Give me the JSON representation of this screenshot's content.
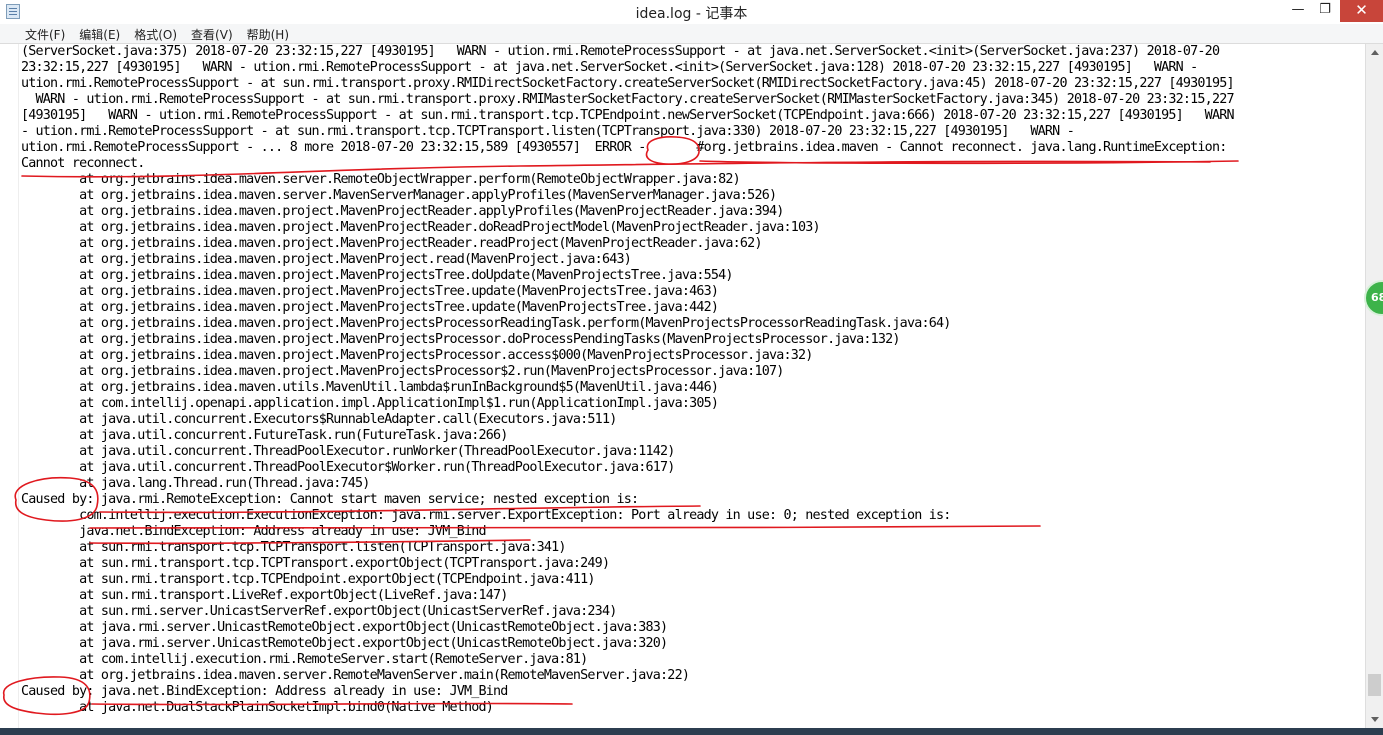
{
  "window": {
    "title": "idea.log - 记事本",
    "minimize_glyph": "—",
    "maximize_glyph": "❐",
    "close_glyph": "✕"
  },
  "menu": [
    "文件(F)",
    "编辑(E)",
    "格式(O)",
    "查看(V)",
    "帮助(H)"
  ],
  "log_lines": [
    "(ServerSocket.java:375) 2018-07-20 23:32:15,227 [4930195]   WARN - ution.rmi.RemoteProcessSupport - at java.net.ServerSocket.<init>(ServerSocket.java:237) 2018-07-20",
    "23:32:15,227 [4930195]   WARN - ution.rmi.RemoteProcessSupport - at java.net.ServerSocket.<init>(ServerSocket.java:128) 2018-07-20 23:32:15,227 [4930195]   WARN -",
    "ution.rmi.RemoteProcessSupport - at sun.rmi.transport.proxy.RMIDirectSocketFactory.createServerSocket(RMIDirectSocketFactory.java:45) 2018-07-20 23:32:15,227 [4930195]",
    "  WARN - ution.rmi.RemoteProcessSupport - at sun.rmi.transport.proxy.RMIMasterSocketFactory.createServerSocket(RMIMasterSocketFactory.java:345) 2018-07-20 23:32:15,227",
    "[4930195]   WARN - ution.rmi.RemoteProcessSupport - at sun.rmi.transport.tcp.TCPEndpoint.newServerSocket(TCPEndpoint.java:666) 2018-07-20 23:32:15,227 [4930195]   WARN",
    "- ution.rmi.RemoteProcessSupport - at sun.rmi.transport.tcp.TCPTransport.listen(TCPTransport.java:330) 2018-07-20 23:32:15,227 [4930195]   WARN -",
    "ution.rmi.RemoteProcessSupport - ... 8 more 2018-07-20 23:32:15,589 [4930557]  ERROR -       #org.jetbrains.idea.maven - Cannot reconnect. java.lang.RuntimeException:",
    "Cannot reconnect.",
    "        at org.jetbrains.idea.maven.server.RemoteObjectWrapper.perform(RemoteObjectWrapper.java:82)",
    "        at org.jetbrains.idea.maven.server.MavenServerManager.applyProfiles(MavenServerManager.java:526)",
    "        at org.jetbrains.idea.maven.project.MavenProjectReader.applyProfiles(MavenProjectReader.java:394)",
    "        at org.jetbrains.idea.maven.project.MavenProjectReader.doReadProjectModel(MavenProjectReader.java:103)",
    "        at org.jetbrains.idea.maven.project.MavenProjectReader.readProject(MavenProjectReader.java:62)",
    "        at org.jetbrains.idea.maven.project.MavenProject.read(MavenProject.java:643)",
    "        at org.jetbrains.idea.maven.project.MavenProjectsTree.doUpdate(MavenProjectsTree.java:554)",
    "        at org.jetbrains.idea.maven.project.MavenProjectsTree.update(MavenProjectsTree.java:463)",
    "        at org.jetbrains.idea.maven.project.MavenProjectsTree.update(MavenProjectsTree.java:442)",
    "        at org.jetbrains.idea.maven.project.MavenProjectsProcessorReadingTask.perform(MavenProjectsProcessorReadingTask.java:64)",
    "        at org.jetbrains.idea.maven.project.MavenProjectsProcessor.doProcessPendingTasks(MavenProjectsProcessor.java:132)",
    "        at org.jetbrains.idea.maven.project.MavenProjectsProcessor.access$000(MavenProjectsProcessor.java:32)",
    "        at org.jetbrains.idea.maven.project.MavenProjectsProcessor$2.run(MavenProjectsProcessor.java:107)",
    "        at org.jetbrains.idea.maven.utils.MavenUtil.lambda$runInBackground$5(MavenUtil.java:446)",
    "        at com.intellij.openapi.application.impl.ApplicationImpl$1.run(ApplicationImpl.java:305)",
    "        at java.util.concurrent.Executors$RunnableAdapter.call(Executors.java:511)",
    "        at java.util.concurrent.FutureTask.run(FutureTask.java:266)",
    "        at java.util.concurrent.ThreadPoolExecutor.runWorker(ThreadPoolExecutor.java:1142)",
    "        at java.util.concurrent.ThreadPoolExecutor$Worker.run(ThreadPoolExecutor.java:617)",
    "        at java.lang.Thread.run(Thread.java:745)",
    "Caused by: java.rmi.RemoteException: Cannot start maven service; nested exception is:",
    "        com.intellij.execution.ExecutionException: java.rmi.server.ExportException: Port already in use: 0; nested exception is:",
    "        java.net.BindException: Address already in use: JVM_Bind",
    "        at sun.rmi.transport.tcp.TCPTransport.listen(TCPTransport.java:341)",
    "        at sun.rmi.transport.tcp.TCPTransport.exportObject(TCPTransport.java:249)",
    "        at sun.rmi.transport.tcp.TCPEndpoint.exportObject(TCPEndpoint.java:411)",
    "        at sun.rmi.transport.LiveRef.exportObject(LiveRef.java:147)",
    "        at sun.rmi.server.UnicastServerRef.exportObject(UnicastServerRef.java:234)",
    "        at java.rmi.server.UnicastRemoteObject.exportObject(UnicastRemoteObject.java:383)",
    "        at java.rmi.server.UnicastRemoteObject.exportObject(UnicastRemoteObject.java:320)",
    "        at com.intellij.execution.rmi.RemoteServer.start(RemoteServer.java:81)",
    "        at org.jetbrains.idea.maven.server.RemoteMavenServer.main(RemoteMavenServer.java:22)",
    "Caused by: java.net.BindException: Address already in use: JVM_Bind",
    "        at java.net.DualStackPlainSocketImpl.bind0(Native Method)"
  ],
  "side_badge": "68",
  "colors": {
    "annotation": "#e0191f",
    "badge": "#3db34a",
    "close_button": "#c8453a"
  }
}
